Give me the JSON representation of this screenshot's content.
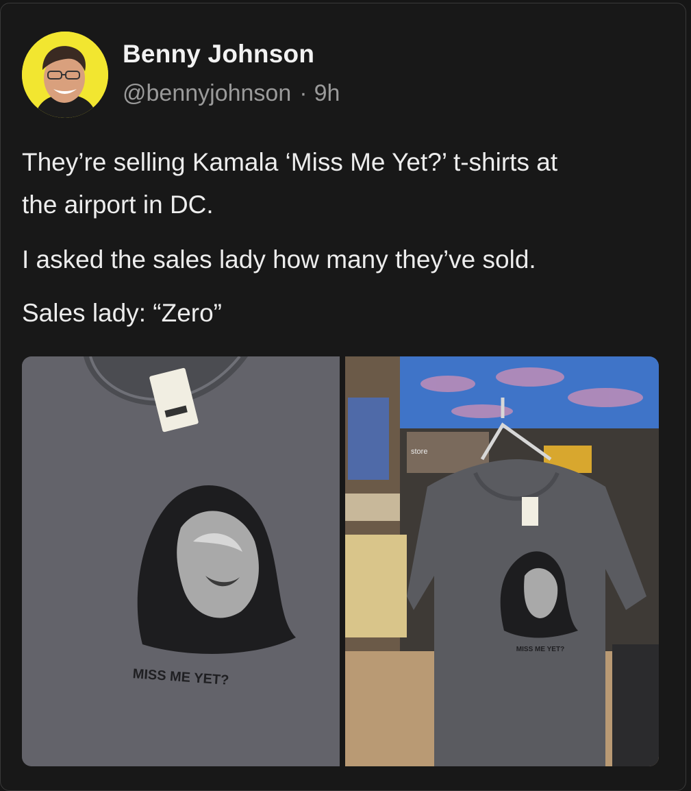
{
  "post": {
    "author_name": "Benny Johnson",
    "author_handle": "@bennyjohnson",
    "separator": "·",
    "time_ago": "9h",
    "text_lines": [
      "They’re selling Kamala ‘Miss Me Yet?’ t-shirts at",
      "the airport in DC.",
      "I asked the sales lady how many they’ve sold.",
      "Sales lady: “Zero”"
    ]
  },
  "media": {
    "left_photo": {
      "shirt_print": "MISS ME YET?"
    },
    "right_photo": {
      "shirt_print": "MISS ME YET?",
      "store_sign": "store"
    }
  },
  "colors": {
    "background": "#181818",
    "text": "#ededed",
    "muted": "#9a9a9a",
    "avatar_bg": "#f2e630"
  }
}
